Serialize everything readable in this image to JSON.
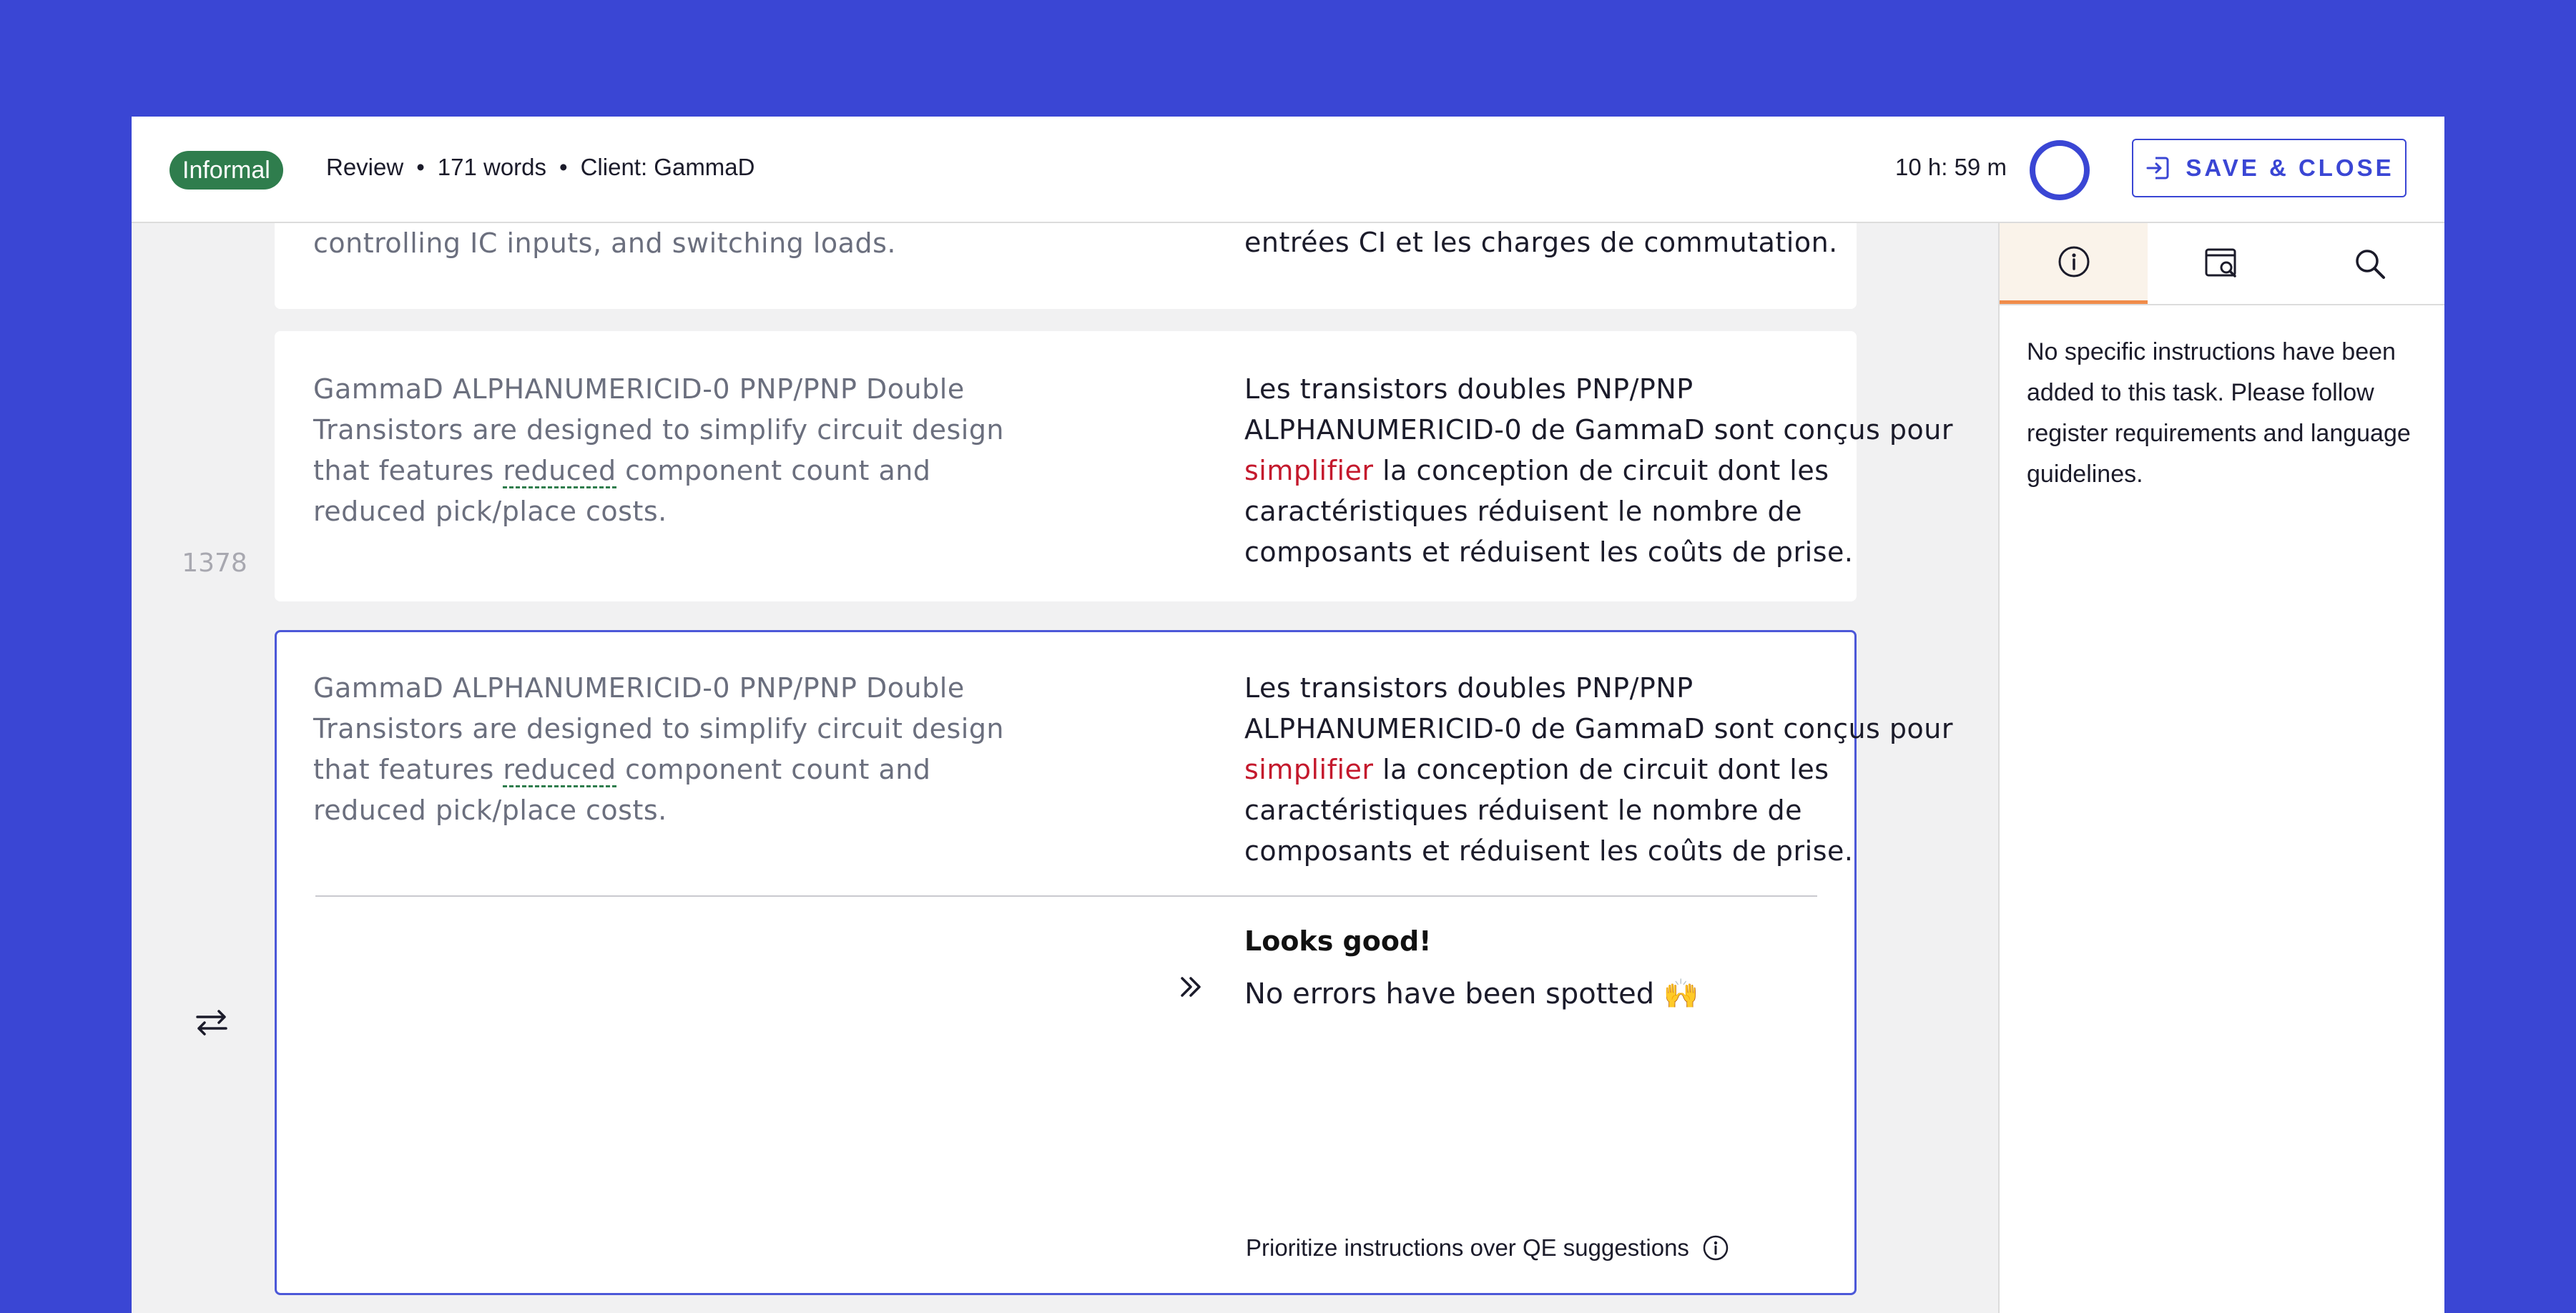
{
  "header": {
    "register_badge": "Informal",
    "task_type": "Review",
    "word_count": "171 words",
    "client": "Client: GammaD",
    "separator": "•",
    "timer": "10 h: 59 m",
    "save_label": "SAVE & CLOSE"
  },
  "segments": [
    {
      "source": "controlling IC inputs, and switching loads.",
      "target": "d'économie pour la série DESO, le contrôle des entrées CI et les charges de commutation."
    },
    {
      "number": "1378",
      "source_pre": "GammaD ALPHANUMERICID-0 PNP/PNP Double Transistors are designed to simplify circuit design that features ",
      "source_flag": "reduced",
      "source_post": " component count and reduced pick/place costs.",
      "target_pre": "Les transistors doubles PNP/PNP ALPHANUMERICID-0 de GammaD sont conçus pour ",
      "target_flag": "simplifier",
      "target_post": " la conception de circuit dont les caractéristiques réduisent le nombre de composants et réduisent les coûts de prise."
    },
    {
      "source_pre": "GammaD ALPHANUMERICID-0 PNP/PNP Double Transistors are designed to simplify circuit design that features ",
      "source_flag": "reduced",
      "source_post": " component count and reduced pick/place costs.",
      "target_pre": "Les transistors doubles PNP/PNP ALPHANUMERICID-0 de GammaD sont conçus pour ",
      "target_flag": "simplifier",
      "target_post": " la conception de circuit dont les caractéristiques réduisent le nombre de composants et réduisent les coûts de prise.",
      "qa_title": "Looks good!",
      "qa_message": "No errors have been spotted",
      "qa_emoji": "🙌",
      "priority_note": "Prioritize instructions over QE suggestions"
    }
  ],
  "panel": {
    "tabs": [
      "info-icon",
      "preview-search-icon",
      "search-icon"
    ],
    "instructions": "No specific instructions have been added to this task. Please follow register requirements and language guidelines."
  },
  "colors": {
    "brand": "#3a46d4",
    "register_badge": "#2f7d4d",
    "highlight": "#c4182c",
    "active_tab": "#f08c4a"
  }
}
